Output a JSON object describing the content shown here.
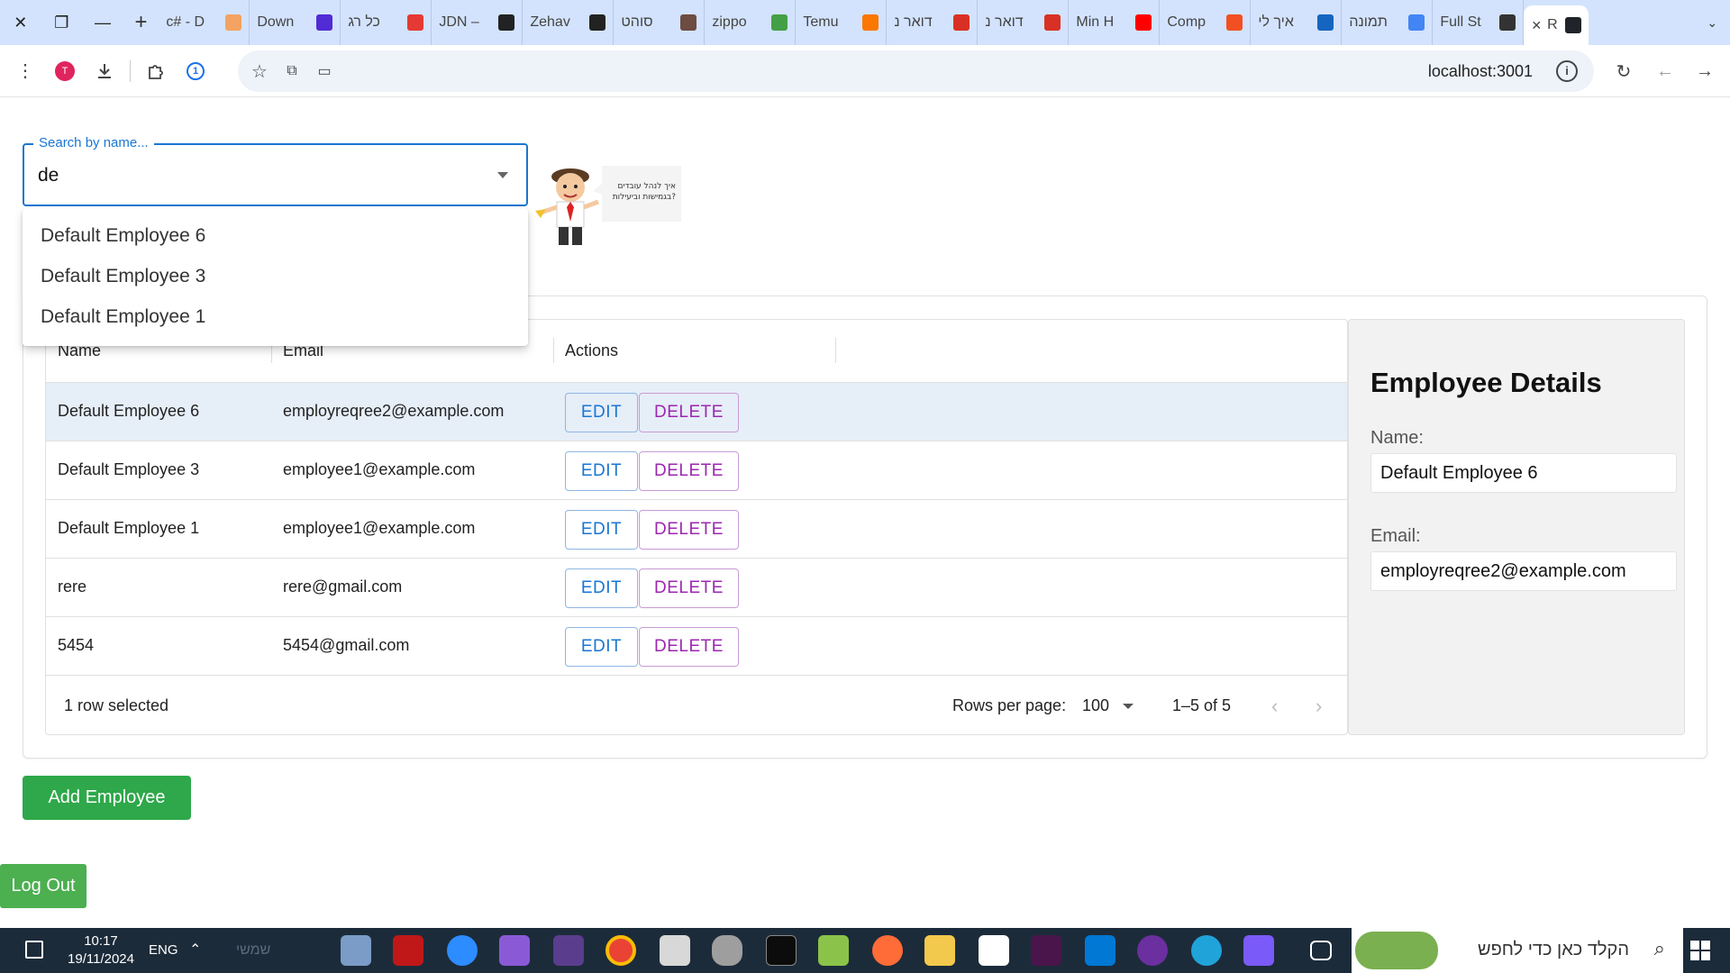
{
  "browser": {
    "tabs": [
      {
        "label": "c# - D",
        "color": "#f4a261"
      },
      {
        "label": "Down",
        "color": "#512bd4"
      },
      {
        "label": "כל רג",
        "color": "#e53935"
      },
      {
        "label": "JDN –",
        "color": "#222222"
      },
      {
        "label": "Zehav",
        "color": "#222222"
      },
      {
        "label": "סוהט",
        "color": "#6d4c41"
      },
      {
        "label": "zippo",
        "color": "#43a047"
      },
      {
        "label": "Temu",
        "color": "#fb7701"
      },
      {
        "label": "דואר נ",
        "color": "#d93025"
      },
      {
        "label": "דואר נ",
        "color": "#d93025"
      },
      {
        "label": "Min H",
        "color": "#ff0000"
      },
      {
        "label": "Comp",
        "color": "#f25022"
      },
      {
        "label": "איך לי",
        "color": "#1565c0"
      },
      {
        "label": "תמונה",
        "color": "#4285f4"
      },
      {
        "label": "Full St",
        "color": "#333333"
      },
      {
        "label": "Re",
        "color": "#20232a",
        "active": true
      }
    ],
    "url": "localhost:3001",
    "extension_badge": "T"
  },
  "search": {
    "label": "Search by name...",
    "value": "de",
    "options": [
      "Default Employee 6",
      "Default Employee 3",
      "Default Employee 1"
    ]
  },
  "mascot": {
    "bubble_text_line1": "איך לנהל עובדים",
    "bubble_text_line2": "בגמישות וביעילות?"
  },
  "table": {
    "headers": {
      "name": "Name",
      "email": "Email",
      "actions": "Actions"
    },
    "rows": [
      {
        "name": "Default Employee 6",
        "email": "employreqree2@example.com",
        "selected": true
      },
      {
        "name": "Default Employee 3",
        "email": "employee1@example.com"
      },
      {
        "name": "Default Employee 1",
        "email": "employee1@example.com"
      },
      {
        "name": "rere",
        "email": "rere@gmail.com"
      },
      {
        "name": "5454",
        "email": "5454@gmail.com"
      }
    ],
    "edit_label": "EDIT",
    "delete_label": "DELETE",
    "footer": {
      "selected_text": "1 row selected",
      "rows_per_page_label": "Rows per page:",
      "rows_per_page_value": "100",
      "range_text": "1–5 of 5"
    }
  },
  "details": {
    "title": "Employee Details",
    "name_label": "Name:",
    "name_value": "Default Employee 6",
    "email_label": "Email:",
    "email_value": "employreqree2@example.com"
  },
  "actions": {
    "add_employee": "Add Employee",
    "log_out": "Log Out"
  },
  "taskbar": {
    "time": "10:17",
    "date": "19/11/2024",
    "language": "ENG",
    "search_placeholder": "הקלד כאן כדי לחפש",
    "weather_text": "שמשי"
  },
  "colors": {
    "accent_blue": "#1976d2",
    "delete_purple": "#9c27b0",
    "add_green": "#2ea84a",
    "logout_green": "#4caf50",
    "selected_row": "#e6eef8"
  }
}
